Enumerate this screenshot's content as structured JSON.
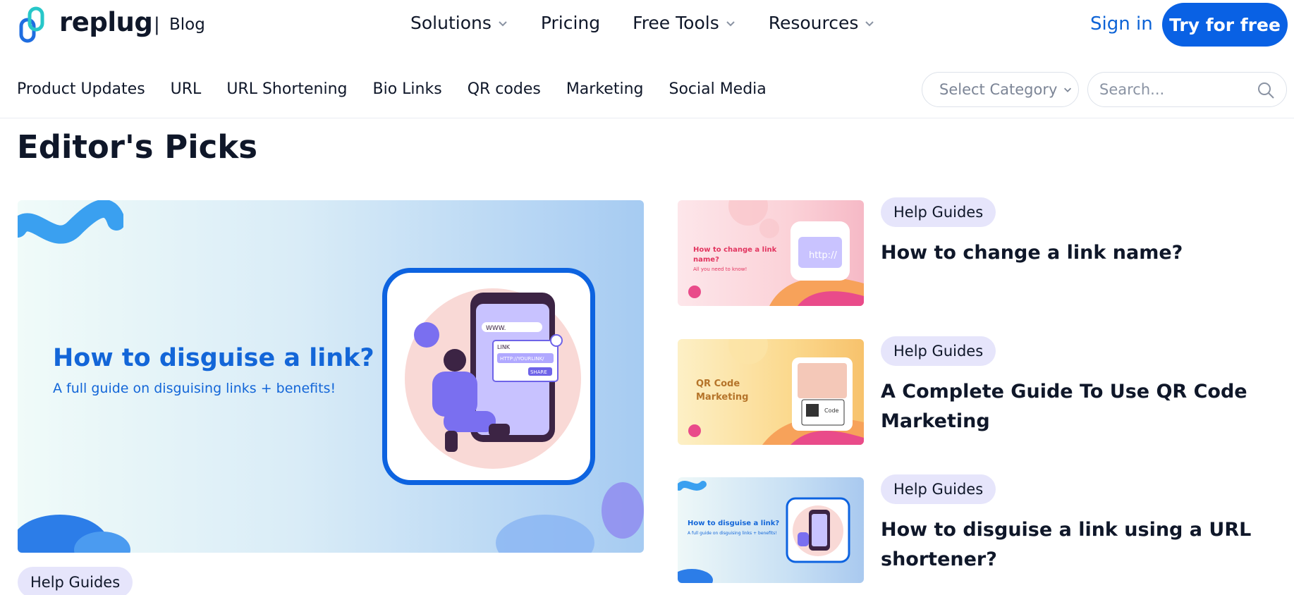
{
  "header": {
    "brand": "replug",
    "separator": "|",
    "section": "Blog",
    "nav": [
      {
        "label": "Solutions",
        "has_menu": true
      },
      {
        "label": "Pricing",
        "has_menu": false
      },
      {
        "label": "Free Tools",
        "has_menu": true
      },
      {
        "label": "Resources",
        "has_menu": true
      }
    ],
    "signin_label": "Sign in",
    "cta_label": "Try for free"
  },
  "categories": {
    "items": [
      "Product Updates",
      "URL",
      "URL Shortening",
      "Bio Links",
      "QR codes",
      "Marketing",
      "Social Media"
    ],
    "select_label": "Select Category",
    "search_placeholder": "Search..."
  },
  "main": {
    "heading": "Editor's Picks",
    "featured": {
      "title": "How to disguise a link?",
      "subtitle": "A full guide on disguising links + benefits!",
      "tag": "Help Guides",
      "card_labels": {
        "www": "WWW.",
        "link": "LINK",
        "url": "HTTP://YOURLINK/",
        "share": "SHARE"
      }
    },
    "posts": [
      {
        "tag": "Help Guides",
        "title": "How to change a link name?",
        "thumb_title": "How to change a link name?",
        "thumb_sub": "All you need to know!",
        "thumb_badge": "http://"
      },
      {
        "tag": "Help Guides",
        "title": "A Complete Guide To Use QR Code Marketing",
        "thumb_title_1": "QR Code",
        "thumb_title_2": "Marketing",
        "thumb_badge": "Code"
      },
      {
        "tag": "Help Guides",
        "title": "How to disguise a link using a URL shortener?",
        "thumb_title": "How to disguise a link?",
        "thumb_sub": "A full guide on disguising links + benefits!"
      }
    ]
  },
  "colors": {
    "primary": "#0961e4",
    "link": "#0d63d6",
    "heading": "#0f1729",
    "tag_bg": "#e6e5fb"
  }
}
